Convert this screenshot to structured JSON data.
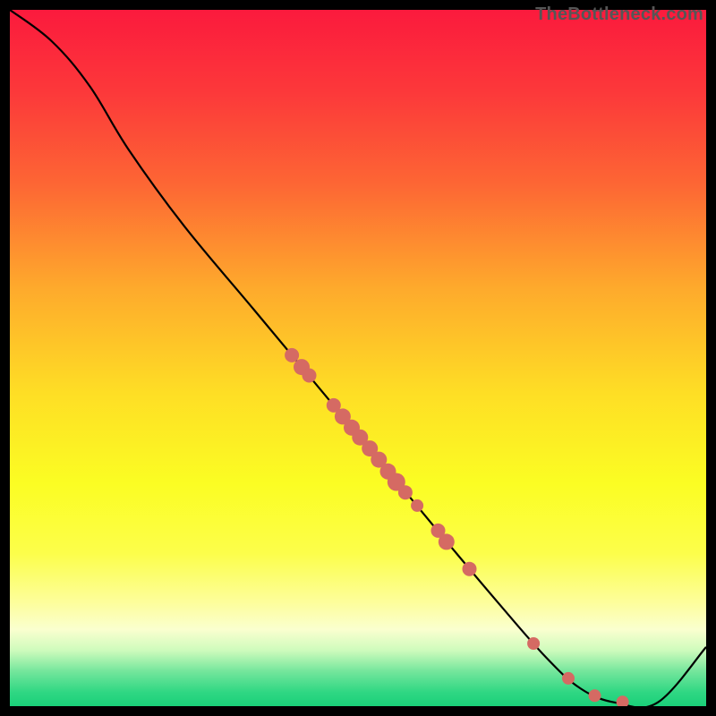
{
  "attribution": "TheBottleneck.com",
  "chart_data": {
    "type": "line",
    "title": "",
    "xlabel": "",
    "ylabel": "",
    "xlim": [
      0,
      1
    ],
    "ylim": [
      0,
      1
    ],
    "background_gradient": {
      "stops": [
        {
          "offset": 0.0,
          "color": "#fb1a3d"
        },
        {
          "offset": 0.12,
          "color": "#fc393a"
        },
        {
          "offset": 0.25,
          "color": "#fd6634"
        },
        {
          "offset": 0.4,
          "color": "#feaa2c"
        },
        {
          "offset": 0.55,
          "color": "#fede25"
        },
        {
          "offset": 0.68,
          "color": "#fbfd23"
        },
        {
          "offset": 0.78,
          "color": "#fcfe4a"
        },
        {
          "offset": 0.85,
          "color": "#fdfe9a"
        },
        {
          "offset": 0.89,
          "color": "#faffcf"
        },
        {
          "offset": 0.92,
          "color": "#cefbbc"
        },
        {
          "offset": 0.95,
          "color": "#74e69c"
        },
        {
          "offset": 0.98,
          "color": "#2fd783"
        },
        {
          "offset": 1.0,
          "color": "#1ad079"
        }
      ]
    },
    "curve": [
      {
        "x": 0.0,
        "y": 1.0
      },
      {
        "x": 0.06,
        "y": 0.955
      },
      {
        "x": 0.115,
        "y": 0.89
      },
      {
        "x": 0.17,
        "y": 0.8
      },
      {
        "x": 0.25,
        "y": 0.69
      },
      {
        "x": 0.35,
        "y": 0.57
      },
      {
        "x": 0.45,
        "y": 0.45
      },
      {
        "x": 0.55,
        "y": 0.33
      },
      {
        "x": 0.62,
        "y": 0.245
      },
      {
        "x": 0.7,
        "y": 0.15
      },
      {
        "x": 0.77,
        "y": 0.07
      },
      {
        "x": 0.82,
        "y": 0.025
      },
      {
        "x": 0.87,
        "y": 0.005
      },
      {
        "x": 0.93,
        "y": 0.005
      },
      {
        "x": 1.0,
        "y": 0.085
      }
    ],
    "dots": [
      {
        "x": 0.405,
        "y": 0.504,
        "r": 8
      },
      {
        "x": 0.419,
        "y": 0.487,
        "r": 9
      },
      {
        "x": 0.43,
        "y": 0.475,
        "r": 8
      },
      {
        "x": 0.465,
        "y": 0.432,
        "r": 8
      },
      {
        "x": 0.478,
        "y": 0.416,
        "r": 9
      },
      {
        "x": 0.491,
        "y": 0.4,
        "r": 9
      },
      {
        "x": 0.503,
        "y": 0.386,
        "r": 9
      },
      {
        "x": 0.517,
        "y": 0.37,
        "r": 9
      },
      {
        "x": 0.53,
        "y": 0.354,
        "r": 9
      },
      {
        "x": 0.543,
        "y": 0.337,
        "r": 9
      },
      {
        "x": 0.555,
        "y": 0.322,
        "r": 10
      },
      {
        "x": 0.568,
        "y": 0.307,
        "r": 8
      },
      {
        "x": 0.585,
        "y": 0.288,
        "r": 7
      },
      {
        "x": 0.615,
        "y": 0.252,
        "r": 8
      },
      {
        "x": 0.627,
        "y": 0.236,
        "r": 9
      },
      {
        "x": 0.66,
        "y": 0.197,
        "r": 8
      },
      {
        "x": 0.752,
        "y": 0.09,
        "r": 7
      },
      {
        "x": 0.802,
        "y": 0.04,
        "r": 7
      },
      {
        "x": 0.84,
        "y": 0.015,
        "r": 7
      },
      {
        "x": 0.88,
        "y": 0.006,
        "r": 7
      }
    ]
  }
}
